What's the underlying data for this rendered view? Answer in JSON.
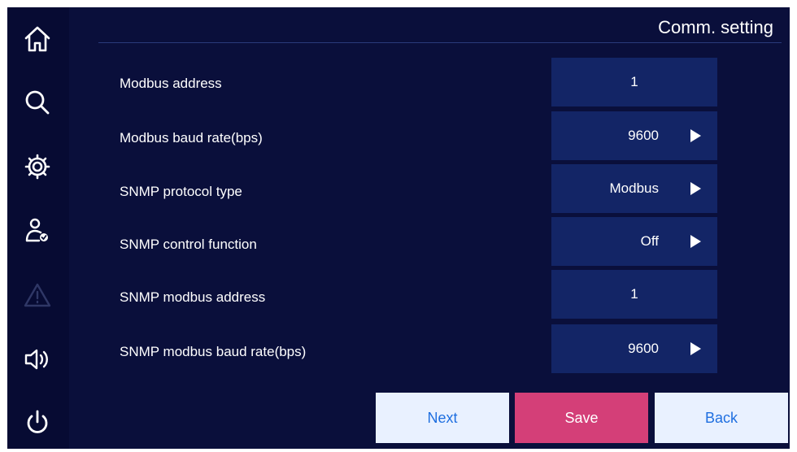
{
  "page": {
    "title": "Comm. setting"
  },
  "sidebar": {
    "icons": [
      {
        "name": "home-icon",
        "enabled": true
      },
      {
        "name": "search-icon",
        "enabled": true
      },
      {
        "name": "gear-icon",
        "enabled": true
      },
      {
        "name": "user-check-icon",
        "enabled": true
      },
      {
        "name": "warning-icon",
        "enabled": false
      },
      {
        "name": "speaker-icon",
        "enabled": true
      },
      {
        "name": "power-icon",
        "enabled": true
      }
    ]
  },
  "settings": [
    {
      "label": "Modbus address",
      "value": "1",
      "has_arrow": false
    },
    {
      "label": "Modbus baud rate(bps)",
      "value": "9600",
      "has_arrow": true
    },
    {
      "label": "SNMP protocol type",
      "value": "Modbus",
      "has_arrow": true
    },
    {
      "label": "SNMP control function",
      "value": "Off",
      "has_arrow": true
    },
    {
      "label": "SNMP modbus address",
      "value": "1",
      "has_arrow": false
    },
    {
      "label": "SNMP modbus baud rate(bps)",
      "value": "9600",
      "has_arrow": true
    }
  ],
  "buttons": {
    "next": "Next",
    "save": "Save",
    "back": "Back"
  },
  "colors": {
    "background": "#0a0f3b",
    "value_box": "#132566",
    "save_button": "#d43f78",
    "nav_button": "#e9f1ff",
    "nav_button_text": "#1f6fe0"
  }
}
